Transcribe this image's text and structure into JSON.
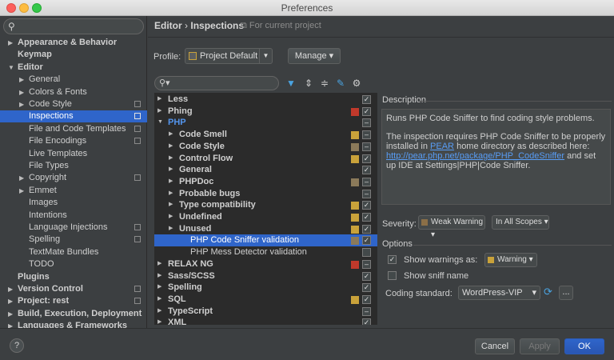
{
  "window": {
    "title": "Preferences"
  },
  "sidebar": {
    "search_placeholder": "",
    "items": [
      {
        "label": "Appearance & Behavior",
        "level": 0,
        "arrow": "▶",
        "bold": true
      },
      {
        "label": "Keymap",
        "level": 0,
        "arrow": "",
        "bold": true
      },
      {
        "label": "Editor",
        "level": 0,
        "arrow": "▼",
        "bold": true
      },
      {
        "label": "General",
        "level": 1,
        "arrow": "▶"
      },
      {
        "label": "Colors & Fonts",
        "level": 1,
        "arrow": "▶"
      },
      {
        "label": "Code Style",
        "level": 1,
        "arrow": "▶",
        "copy": true
      },
      {
        "label": "Inspections",
        "level": 1,
        "arrow": "",
        "copy": true,
        "selected": true
      },
      {
        "label": "File and Code Templates",
        "level": 1,
        "arrow": "",
        "copy": true
      },
      {
        "label": "File Encodings",
        "level": 1,
        "arrow": "",
        "copy": true
      },
      {
        "label": "Live Templates",
        "level": 1,
        "arrow": ""
      },
      {
        "label": "File Types",
        "level": 1,
        "arrow": ""
      },
      {
        "label": "Copyright",
        "level": 1,
        "arrow": "▶",
        "copy": true
      },
      {
        "label": "Emmet",
        "level": 1,
        "arrow": "▶"
      },
      {
        "label": "Images",
        "level": 1,
        "arrow": ""
      },
      {
        "label": "Intentions",
        "level": 1,
        "arrow": ""
      },
      {
        "label": "Language Injections",
        "level": 1,
        "arrow": "",
        "copy": true
      },
      {
        "label": "Spelling",
        "level": 1,
        "arrow": "",
        "copy": true
      },
      {
        "label": "TextMate Bundles",
        "level": 1,
        "arrow": ""
      },
      {
        "label": "TODO",
        "level": 1,
        "arrow": ""
      },
      {
        "label": "Plugins",
        "level": 0,
        "arrow": "",
        "bold": true
      },
      {
        "label": "Version Control",
        "level": 0,
        "arrow": "▶",
        "bold": true,
        "copy": true
      },
      {
        "label": "Project: rest",
        "level": 0,
        "arrow": "▶",
        "bold": true,
        "copy": true
      },
      {
        "label": "Build, Execution, Deployment",
        "level": 0,
        "arrow": "▶",
        "bold": true
      },
      {
        "label": "Languages & Frameworks",
        "level": 0,
        "arrow": "▶",
        "bold": true
      }
    ]
  },
  "header": {
    "breadcrumb_parent": "Editor",
    "breadcrumb_sep": "›",
    "breadcrumb_current": "Inspections",
    "project_note": "For current project"
  },
  "profile": {
    "label": "Profile:",
    "value": "Project Default",
    "manage_label": "Manage ▾"
  },
  "inspections": {
    "colors": {
      "error": "#c0392b",
      "warning": "#c9a23a",
      "weak": "#8b7a5a",
      "gray": "#666666"
    },
    "rows": [
      {
        "label": "Less",
        "level": 0,
        "arrow": "▶",
        "bold": true,
        "sev": "",
        "check": "✓"
      },
      {
        "label": "Phing",
        "level": 0,
        "arrow": "▶",
        "bold": true,
        "sev": "error",
        "check": "✓"
      },
      {
        "label": "PHP",
        "level": 0,
        "arrow": "▼",
        "bold": true,
        "php": true,
        "sev": "",
        "check": "–"
      },
      {
        "label": "Code Smell",
        "level": 1,
        "arrow": "▶",
        "bold": true,
        "sev": "warning",
        "check": "–"
      },
      {
        "label": "Code Style",
        "level": 1,
        "arrow": "▶",
        "bold": true,
        "sev": "weak",
        "check": "–"
      },
      {
        "label": "Control Flow",
        "level": 1,
        "arrow": "▶",
        "bold": true,
        "sev": "warning",
        "check": "✓"
      },
      {
        "label": "General",
        "level": 1,
        "arrow": "▶",
        "bold": true,
        "sev": "",
        "check": "✓"
      },
      {
        "label": "PHPDoc",
        "level": 1,
        "arrow": "▶",
        "bold": true,
        "sev": "weak",
        "check": "–"
      },
      {
        "label": "Probable bugs",
        "level": 1,
        "arrow": "▶",
        "bold": true,
        "sev": "",
        "check": "–"
      },
      {
        "label": "Type compatibility",
        "level": 1,
        "arrow": "▶",
        "bold": true,
        "sev": "warning",
        "check": "✓"
      },
      {
        "label": "Undefined",
        "level": 1,
        "arrow": "▶",
        "bold": true,
        "sev": "warning",
        "check": "✓"
      },
      {
        "label": "Unused",
        "level": 1,
        "arrow": "▶",
        "bold": true,
        "sev": "warning",
        "check": "✓"
      },
      {
        "label": "PHP Code Sniffer validation",
        "level": 2,
        "arrow": "",
        "sev": "weak",
        "check": "✓",
        "selected": true
      },
      {
        "label": "PHP Mess Detector validation",
        "level": 2,
        "arrow": "",
        "sev": "",
        "check": ""
      },
      {
        "label": "RELAX NG",
        "level": 0,
        "arrow": "▶",
        "bold": true,
        "sev": "error",
        "check": "–"
      },
      {
        "label": "Sass/SCSS",
        "level": 0,
        "arrow": "▶",
        "bold": true,
        "sev": "",
        "check": "✓"
      },
      {
        "label": "Spelling",
        "level": 0,
        "arrow": "▶",
        "bold": true,
        "sev": "",
        "check": "✓"
      },
      {
        "label": "SQL",
        "level": 0,
        "arrow": "▶",
        "bold": true,
        "sev": "warning",
        "check": "✓"
      },
      {
        "label": "TypeScript",
        "level": 0,
        "arrow": "▶",
        "bold": true,
        "sev": "",
        "check": "–"
      },
      {
        "label": "XML",
        "level": 0,
        "arrow": "▶",
        "bold": true,
        "sev": "",
        "check": "✓"
      }
    ]
  },
  "description": {
    "title": "Description",
    "p1": "Runs PHP Code Sniffer to find coding style problems.",
    "p2_before": "The inspection requires PHP Code Sniffer to be properly installed in ",
    "p2_link1": "PEAR",
    "p2_mid": " home directory as described here: ",
    "p2_link2": "http://pear.php.net/package/PHP_CodeSniffer",
    "p2_after": " and set up IDE at Settings|PHP|Code Sniffer."
  },
  "severity": {
    "label": "Severity:",
    "value": "Weak Warning",
    "scope": "In All Scopes"
  },
  "options": {
    "title": "Options",
    "show_warnings_label": "Show warnings as:",
    "show_warnings_value": "Warning",
    "show_sniff_label": "Show sniff name",
    "coding_standard_label": "Coding standard:",
    "coding_standard_value": "WordPress-VIP",
    "dots": "..."
  },
  "footer": {
    "help": "?",
    "cancel": "Cancel",
    "apply": "Apply",
    "ok": "OK"
  }
}
